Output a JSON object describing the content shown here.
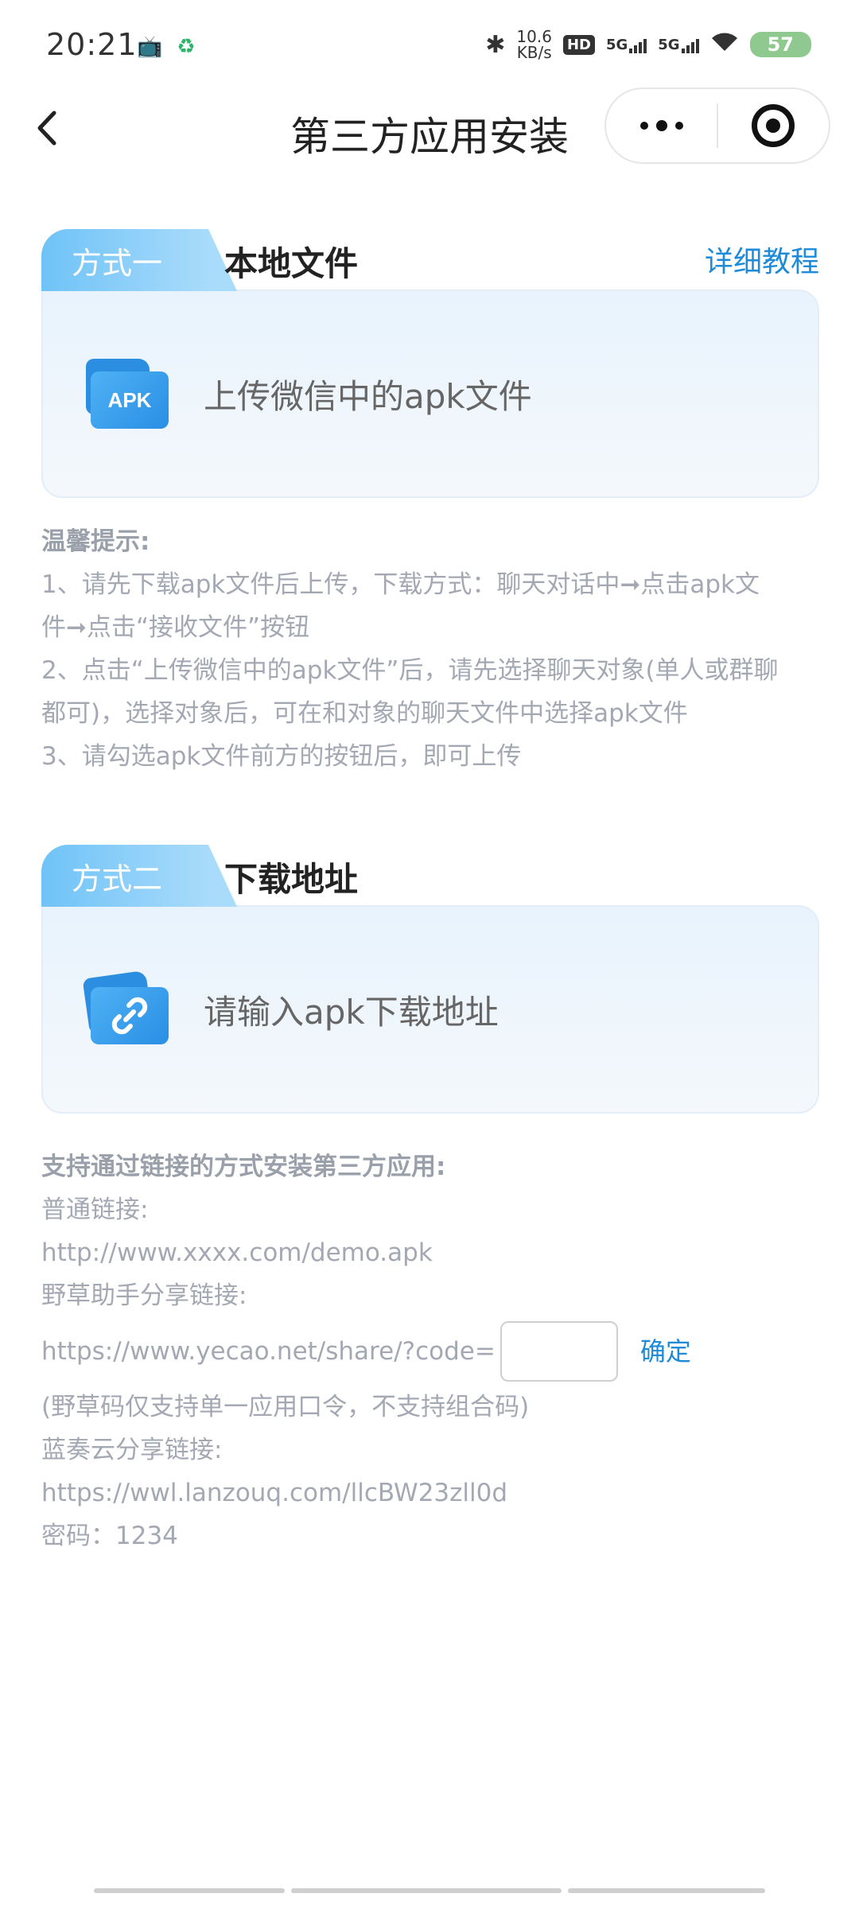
{
  "status_bar": {
    "time": "20:21",
    "net_speed_value": "10.6",
    "net_speed_unit": "KB/s",
    "hd_label": "HD",
    "sim1": "5G",
    "sim2": "5G",
    "battery": "57"
  },
  "nav": {
    "title": "第三方应用安装"
  },
  "method1": {
    "tag": "方式一",
    "title": "本地文件",
    "detail_link": "详细教程",
    "card_icon_text": "APK",
    "card_label": "上传微信中的apk文件"
  },
  "tips1": {
    "title": "温馨提示:",
    "lines": [
      "1、请先下载apk文件后上传，下载方式：聊天对话中➞点击apk文",
      "件➞点击“接收文件”按钮",
      "2、点击“上传微信中的apk文件”后，请先选择聊天对象(单人或群聊",
      "都可)，选择对象后，可在和对象的聊天文件中选择apk文件",
      "3、请勾选apk文件前方的按钮后，即可上传"
    ]
  },
  "method2": {
    "tag": "方式二",
    "title": "下载地址",
    "card_label": "请输入apk下载地址"
  },
  "tips2": {
    "title": "支持通过链接的方式安装第三方应用:",
    "normal_label": "普通链接:",
    "normal_url": "http://www.xxxx.com/demo.apk",
    "yecao_label": "野草助手分享链接:",
    "yecao_url": "https://www.yecao.net/share/?code=",
    "confirm": "确定",
    "yecao_note": "(野草码仅支持单一应用口令，不支持组合码)",
    "lanzou_label": "蓝奏云分享链接:",
    "lanzou_url": "https://wwl.lanzouq.com/llcBW23zll0d",
    "password": "密码：1234"
  }
}
